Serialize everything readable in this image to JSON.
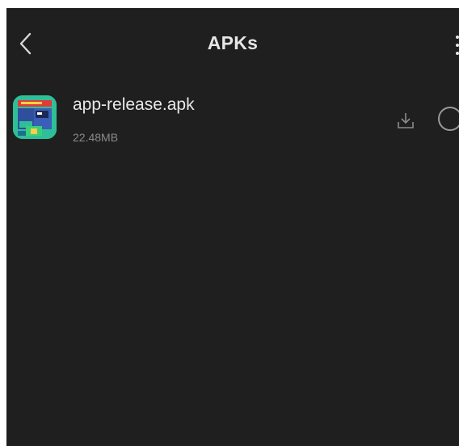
{
  "header": {
    "title": "APKs",
    "back_icon": "chevron-left-icon",
    "menu_icon": "more-vertical-icon"
  },
  "files": [
    {
      "name": "app-release.apk",
      "size": "22.48MB",
      "icon": "apk-app-icon",
      "action_icon": "download-icon",
      "selected": false
    }
  ],
  "colors": {
    "background": "#1f1f1f",
    "title_text": "#e6e6e6",
    "secondary_text": "#8a8a8a"
  }
}
